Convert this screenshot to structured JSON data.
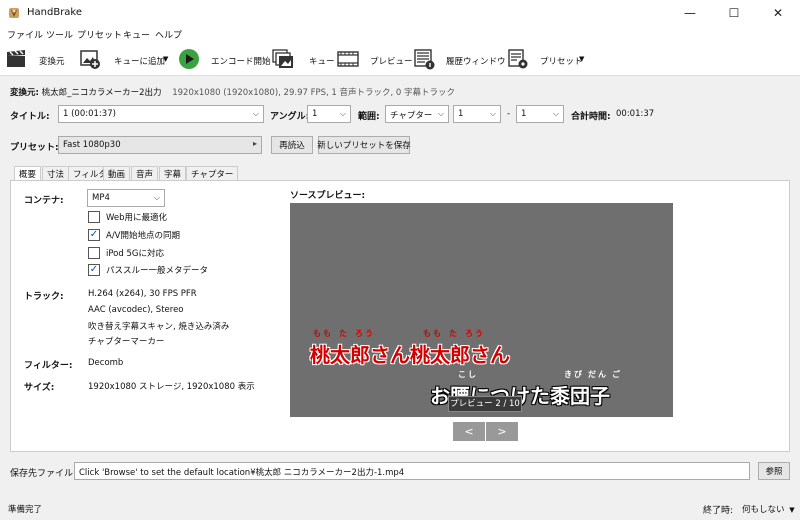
{
  "window": {
    "title": "HandBrake",
    "minimize": "—",
    "maximize": "☐",
    "close": "✕"
  },
  "menu": [
    "ファイル",
    "ツール",
    "プリセット",
    "キュー",
    "ヘルプ"
  ],
  "toolbar": {
    "source": "変換元",
    "add_to_queue": "キューに追加",
    "start_encode": "エンコード開始",
    "queue": "キュー",
    "preview": "プレビュー",
    "activity": "履歴ウィンドウ",
    "presets": "プリセット"
  },
  "source": {
    "label": "変換元:",
    "name": "桃太郎_ニコカラメーカー2出力",
    "info": "1920x1080 (1920x1080), 29.97 FPS, 1 音声トラック, 0 字幕トラック"
  },
  "title_row": {
    "title_label": "タイトル:",
    "title_value": "1 (00:01:37)",
    "angle_label": "アングル:",
    "angle_value": "1",
    "range_label": "範囲:",
    "range_value": "チャプター",
    "range_start": "1",
    "range_sep": "-",
    "range_end": "1",
    "duration_label": "合計時間:",
    "duration_value": "00:01:37"
  },
  "preset_row": {
    "label": "プリセット:",
    "value": "Fast 1080p30",
    "reload": "再読込",
    "save_new": "新しいプリセットを保存"
  },
  "tabs": [
    "概要",
    "寸法",
    "フィルタ",
    "動画",
    "音声",
    "字幕",
    "チャプター"
  ],
  "summary": {
    "container_label": "コンテナ:",
    "container_value": "MP4",
    "options": [
      {
        "label": "Web用に最適化",
        "checked": false
      },
      {
        "label": "A/V開始地点の同期",
        "checked": true
      },
      {
        "label": "iPod 5Gに対応",
        "checked": false
      },
      {
        "label": "パススルー一般メタデータ",
        "checked": true
      }
    ],
    "tracks_label": "トラック:",
    "tracks": [
      "H.264 (x264), 30 FPS PFR",
      "AAC (avcodec), Stereo",
      "吹き替え字幕スキャン, 焼き込み済み",
      "チャプターマーカー"
    ],
    "filters_label": "フィルター:",
    "filters_value": "Decomb",
    "size_label": "サイズ:",
    "size_value": "1920x1080 ストレージ, 1920x1080 表示"
  },
  "preview": {
    "label": "ソースプレビュー:",
    "line1": "桃太郎さん桃太郎さん",
    "line1_ruby": [
      "もも",
      "た",
      "ろう",
      "もも",
      "た",
      "ろう"
    ],
    "line2": "お腰につけた黍団子",
    "line2_ruby": [
      "こし",
      "きび",
      "だん",
      "ご"
    ],
    "tooltip": "プレビュー 2 / 10",
    "prev": "<",
    "next": ">"
  },
  "destination": {
    "label": "保存先ファイル:",
    "value": "Click 'Browse' to set the default location¥桃太郎 ニコカラメーカー2出力-1.mp4",
    "browse": "参照"
  },
  "status": {
    "text": "準備完了",
    "when_done_label": "終了時:",
    "when_done_value": "何もしない"
  },
  "colors": {
    "accent": "#0a4fb5",
    "subtitle_red": "#d40000",
    "preview_bg": "#6f6f6f",
    "start_green": "#3aa340"
  },
  "icons": [
    "handbrake-icon",
    "clapperboard-icon",
    "queue-add-icon",
    "play-icon",
    "queue-icon",
    "film-icon",
    "activity-icon",
    "presets-icon"
  ]
}
